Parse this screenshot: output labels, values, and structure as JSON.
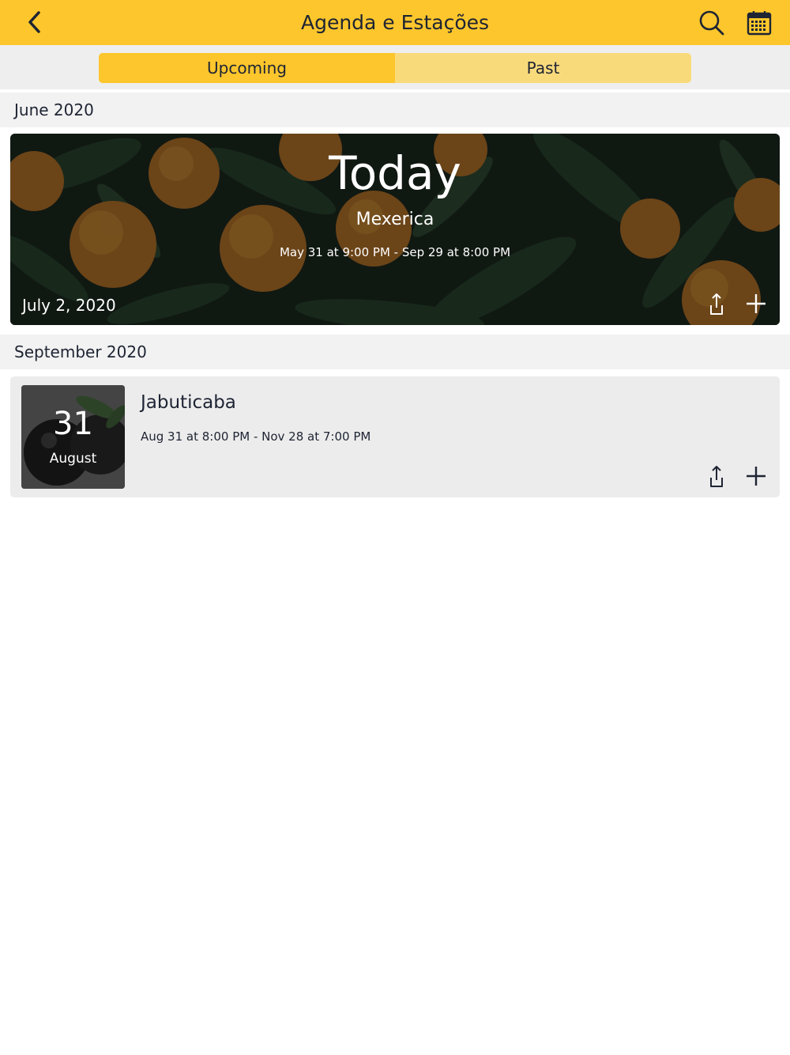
{
  "header": {
    "title": "Agenda e Estações",
    "back_icon": "chevron-left-icon",
    "search_icon": "search-icon",
    "calendar_icon": "calendar-icon",
    "background_color": "#fdc62c"
  },
  "tabs": [
    {
      "label": "Upcoming",
      "selected": true
    },
    {
      "label": "Past",
      "selected": false
    }
  ],
  "sections": [
    {
      "header": "June 2020",
      "featured": {
        "badge": "Today",
        "name": "Mexerica",
        "dates": "May 31 at 9:00 PM - Sep 29 at 8:00 PM",
        "current_date": "July 2, 2020",
        "share_icon": "share-icon",
        "add_icon": "plus-icon"
      }
    },
    {
      "header": "September 2020",
      "event": {
        "day": "31",
        "month": "August",
        "title": "Jabuticaba",
        "dates": "Aug 31 at 8:00 PM - Nov 28 at 7:00 PM",
        "share_icon": "share-icon",
        "add_icon": "plus-icon"
      }
    }
  ]
}
